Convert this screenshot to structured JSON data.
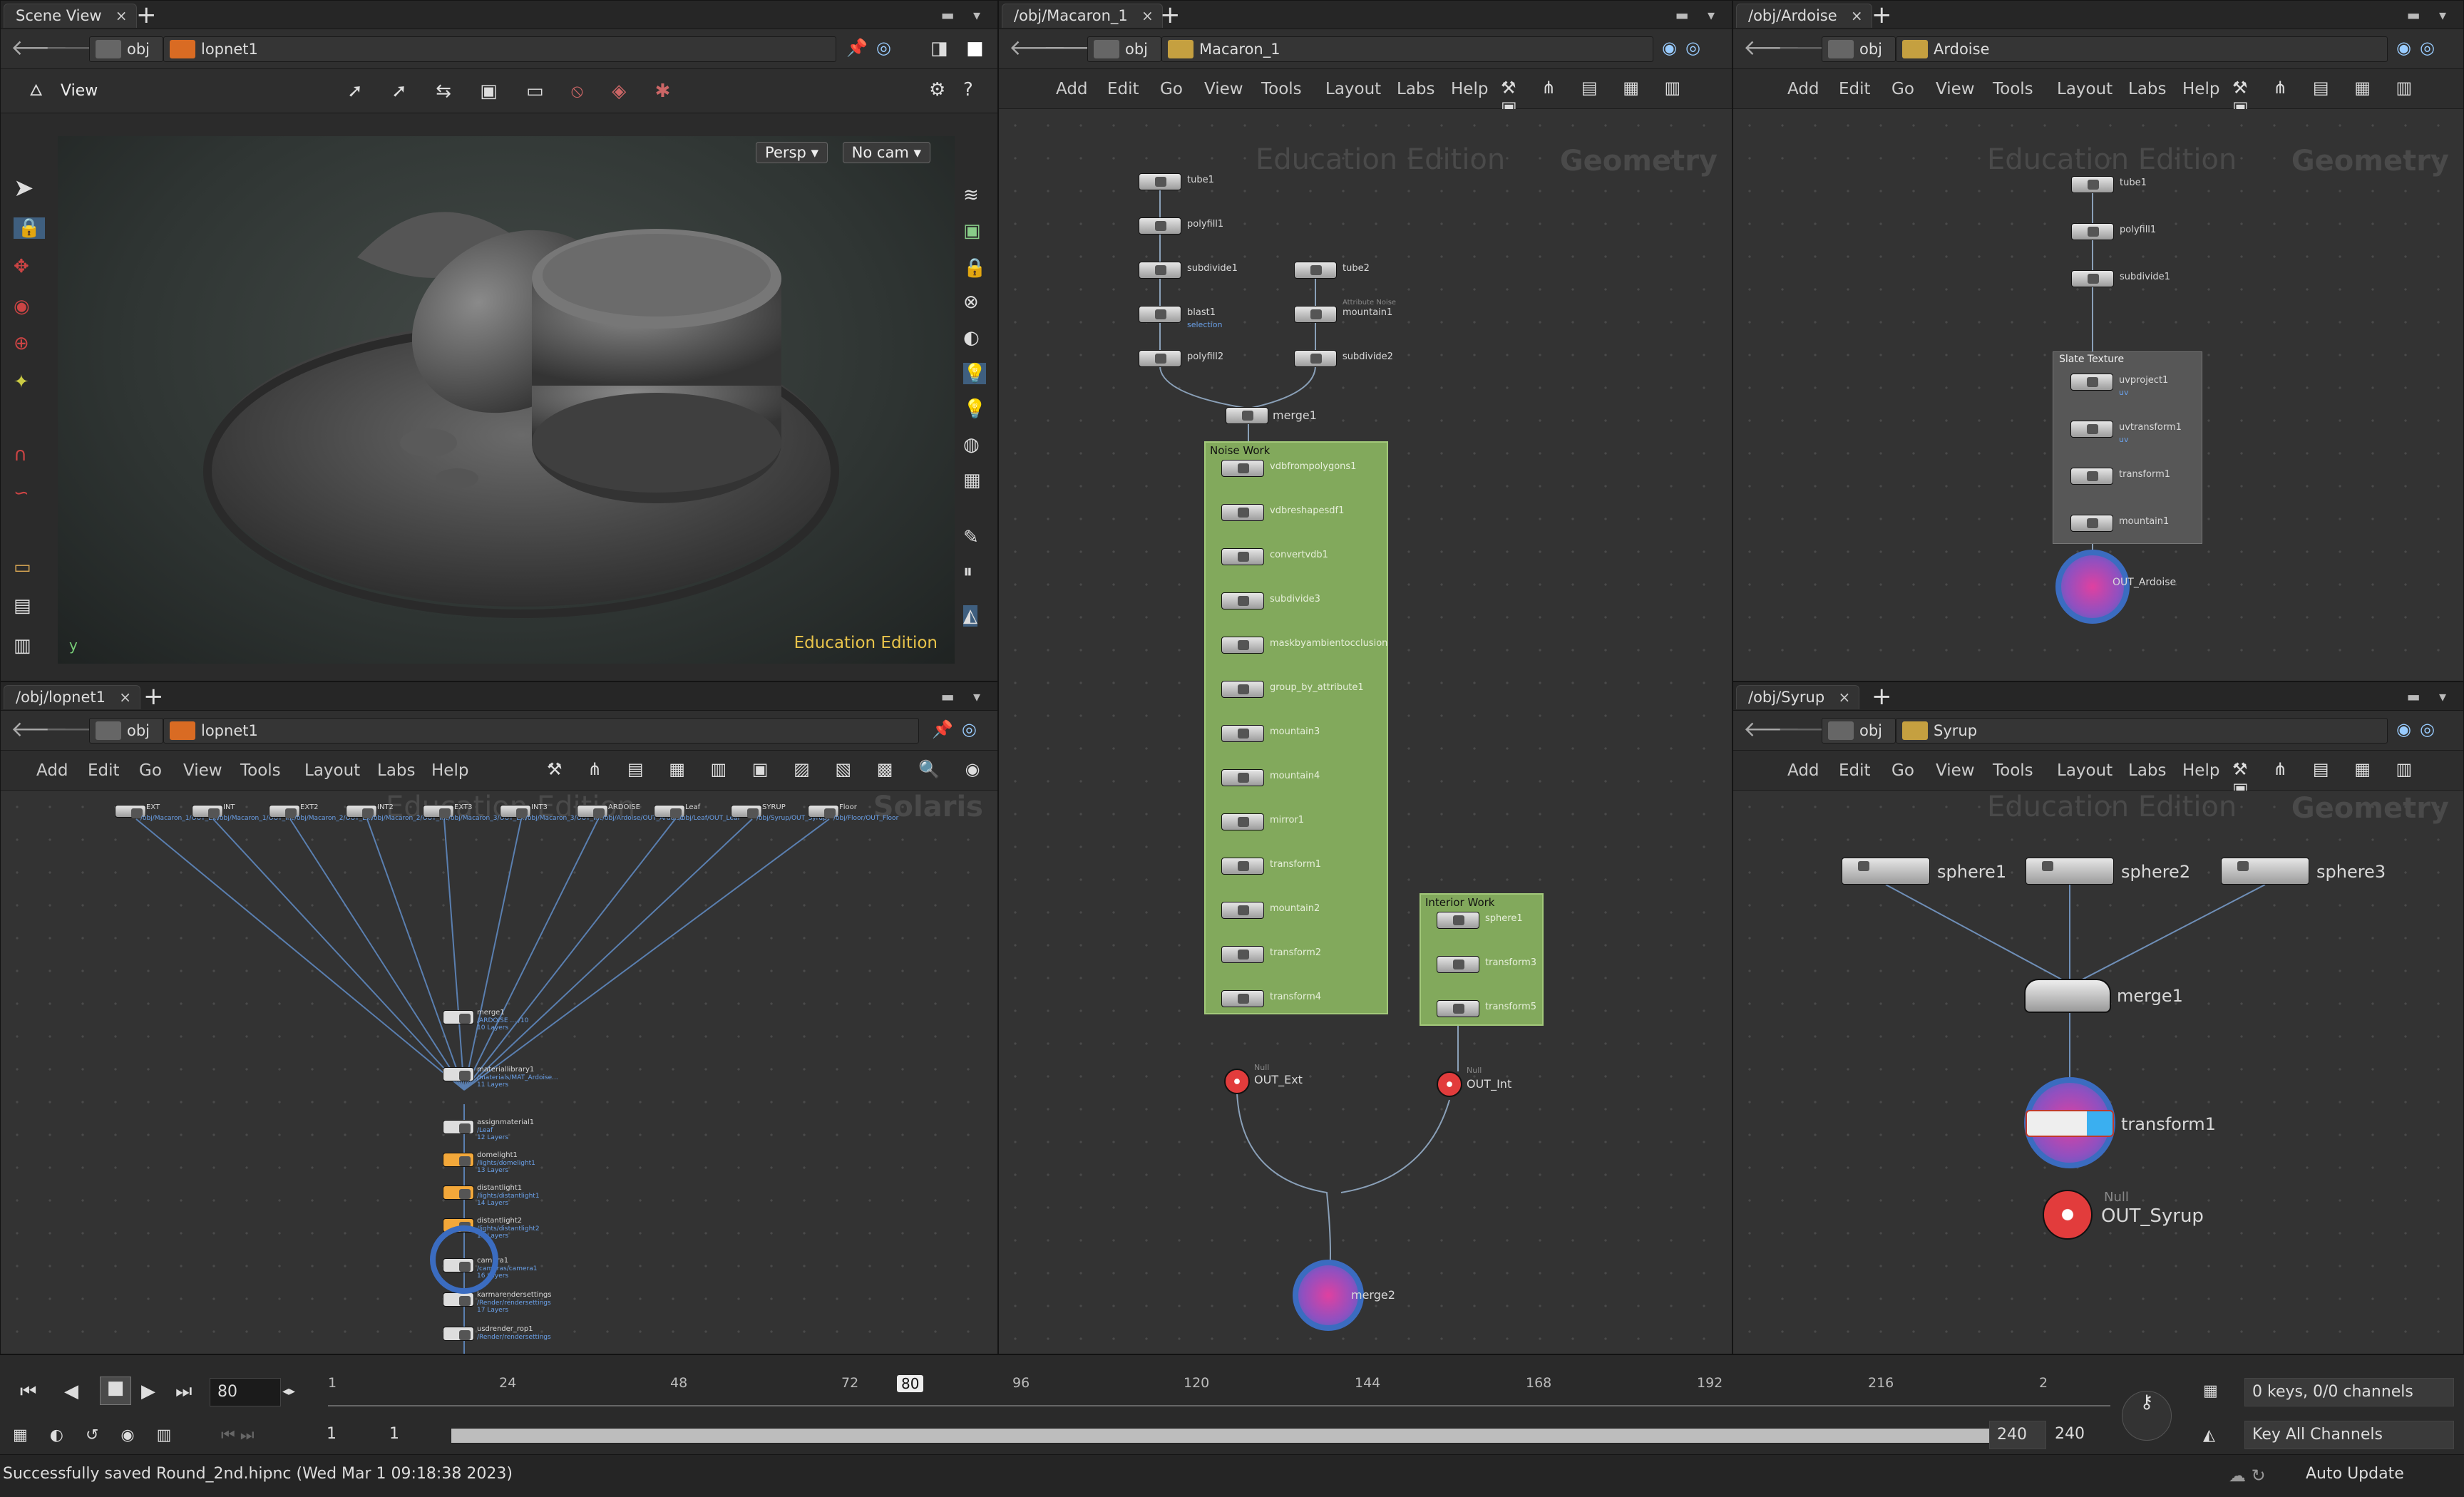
{
  "scene_view": {
    "tab": "Scene View",
    "crumb1": "obj",
    "crumb2": "lopnet1",
    "toolbar_label": "View",
    "persp": "Persp ▾",
    "nocam": "No cam ▾",
    "edition": "Education Edition",
    "axis_label": "y"
  },
  "lop_pane": {
    "tab": "/obj/lopnet1",
    "crumb1": "obj",
    "crumb2": "lopnet1",
    "menus": [
      "Add",
      "Edit",
      "Go",
      "View",
      "Tools",
      "Layout",
      "Labs",
      "Help"
    ],
    "wm_edition": "Education Edition",
    "wm_context": "Solaris",
    "top_nodes": [
      {
        "label": "EXT",
        "sub": "/obj/Macaron_1/OUT_Ext"
      },
      {
        "label": "INT",
        "sub": "/obj/Macaron_1/OUT_Int"
      },
      {
        "label": "EXT2",
        "sub": "/obj/Macaron_2/OUT_Ext"
      },
      {
        "label": "INT2",
        "sub": "/obj/Macaron_2/OUT_Int"
      },
      {
        "label": "EXT3",
        "sub": "/obj/Macaron_3/OUT_Ext"
      },
      {
        "label": "INT3",
        "sub": "/obj/Macaron_3/OUT_Int"
      },
      {
        "label": "ARDOISE",
        "sub": "/obj/Ardoise/OUT_Ardoise"
      },
      {
        "label": "Leaf",
        "sub": "/obj/Leaf/OUT_Leaf"
      },
      {
        "label": "SYRUP",
        "sub": "/obj/Syrup/OUT_Syrup"
      },
      {
        "label": "Floor",
        "sub": "/obj/Floor/OUT_Floor"
      }
    ],
    "chain": [
      {
        "label": "merge1",
        "sub": "/ARDOISE ... /10",
        "sub2": "10 Layers"
      },
      {
        "label": "materiallibrary1",
        "sub": "/materials/MAT_Ardoise...",
        "sub2": "11 Layers"
      },
      {
        "label": "assignmaterial1",
        "sub": "/Leaf",
        "sub2": "12 Layers"
      },
      {
        "label": "domelight1",
        "sub": "/lights/domelight1",
        "sub2": "13 Layers"
      },
      {
        "label": "distantlight1",
        "sub": "/lights/distantlight1",
        "sub2": "14 Layers"
      },
      {
        "label": "distantlight2",
        "sub": "/lights/distantlight2",
        "sub2": "15 Layers"
      },
      {
        "label": "camera1",
        "sub": "/cameras/camera1",
        "sub2": "16 Layers"
      },
      {
        "label": "karmarendersettings",
        "sub": "/Render/rendersettings",
        "sub2": "17 Layers"
      },
      {
        "label": "usdrender_rop1",
        "sub": "/Render/rendersettings"
      }
    ]
  },
  "macaron": {
    "tab": "/obj/Macaron_1",
    "crumb1": "obj",
    "crumb2": "Macaron_1",
    "menus": [
      "Add",
      "Edit",
      "Go",
      "View",
      "Tools",
      "Layout",
      "Labs",
      "Help"
    ],
    "wm_edition": "Education Edition",
    "wm_context": "Geometry",
    "left_col": [
      "tube1",
      "polyfill1",
      "subdivide1",
      "blast1",
      "polyfill2"
    ],
    "blast_sub": "selection",
    "right_col": [
      "tube2",
      "mountain1",
      "subdivide2"
    ],
    "mountain_tag": "Attribute Noise",
    "merge": "merge1",
    "noise_title": "Noise Work",
    "noise_nodes": [
      "vdbfrompolygons1",
      "vdbreshapesdf1",
      "convertvdb1",
      "subdivide3",
      "maskbyambientocclusion",
      "group_by_attribute1",
      "mountain3",
      "mountain4",
      "mirror1",
      "transform1",
      "mountain2",
      "transform2",
      "transform4"
    ],
    "interior_title": "Interior Work",
    "interior_nodes": [
      "sphere1",
      "transform3",
      "transform5"
    ],
    "null_tag": "Null",
    "out_ext": "OUT_Ext",
    "out_int": "OUT_Int",
    "final_merge": "merge2"
  },
  "ardoise": {
    "tab": "/obj/Ardoise",
    "crumb1": "obj",
    "crumb2": "Ardoise",
    "menus": [
      "Add",
      "Edit",
      "Go",
      "View",
      "Tools",
      "Layout",
      "Labs",
      "Help"
    ],
    "wm_edition": "Education Edition",
    "wm_context": "Geometry",
    "nodes": [
      "tube1",
      "polyfill1",
      "subdivide1"
    ],
    "box_title": "Slate Texture",
    "box_nodes": [
      "uvproject1",
      "uvtransform1",
      "transform1",
      "mountain1"
    ],
    "uv_sub": "uv",
    "out": "OUT_Ardoise"
  },
  "syrup": {
    "tab": "/obj/Syrup",
    "crumb1": "obj",
    "crumb2": "Syrup",
    "menus": [
      "Add",
      "Edit",
      "Go",
      "View",
      "Tools",
      "Layout",
      "Labs",
      "Help"
    ],
    "wm_edition": "Education Edition",
    "wm_context": "Geometry",
    "spheres": [
      "sphere1",
      "sphere2",
      "sphere3"
    ],
    "merge": "merge1",
    "transform": "transform1",
    "null_tag": "Null",
    "out": "OUT_Syrup"
  },
  "timeline": {
    "frame": "80",
    "ticks": [
      "1",
      "24",
      "48",
      "72",
      "96",
      "120",
      "144",
      "168",
      "192",
      "216",
      "2"
    ],
    "current_marker": "80",
    "start1": "1",
    "start2": "1",
    "end1": "240",
    "end2": "240",
    "keys": "0 keys, 0/0 channels",
    "key_all": "Key All Channels"
  },
  "status": {
    "message": "Successfully saved Round_2nd.hipnc (Wed Mar  1 09:18:38 2023)",
    "auto_update": "Auto Update"
  }
}
